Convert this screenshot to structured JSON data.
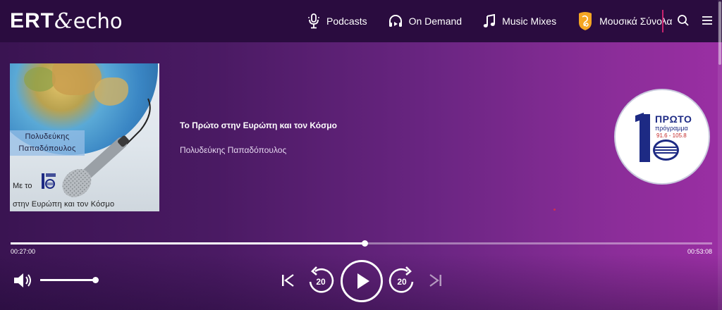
{
  "brand": {
    "part1": "ERT",
    "part2": "echo"
  },
  "nav": {
    "items": [
      {
        "label": "Podcasts",
        "icon": "podcast-mic-icon"
      },
      {
        "label": "On Demand",
        "icon": "headphones-icon"
      },
      {
        "label": "Music Mixes",
        "icon": "music-note-icon"
      },
      {
        "label": "Μουσικά Σύνολα",
        "icon": "ensembles-badge-icon"
      }
    ],
    "search_icon": "search-icon",
    "menu_icon": "hamburger-menu-icon"
  },
  "cover": {
    "name_line1": "Πολυδεύκης",
    "name_line2": "Παπαδόπουλος",
    "me_to": "Με το",
    "subtitle": "στην Ευρώπη και τον Κόσμο"
  },
  "episode": {
    "title": "Το Πρώτο στην Ευρώπη και τον Κόσμο",
    "author": "Πολυδεύκης Παπαδόπουλος"
  },
  "station": {
    "name": "ΠΡΩΤΟ",
    "program": "πρόγραμμα",
    "frequency": "91.6 - 105.8"
  },
  "player": {
    "elapsed": "00:27:00",
    "total": "00:53:08",
    "progress": 0.505,
    "volume": 0.98,
    "rewind_seconds": "20",
    "forward_seconds": "20"
  },
  "colors": {
    "header_bg": "#2a0c3f",
    "accent_divider": "#c8246e",
    "gradient_start": "#3a1452",
    "gradient_end": "#9a2fa3"
  }
}
